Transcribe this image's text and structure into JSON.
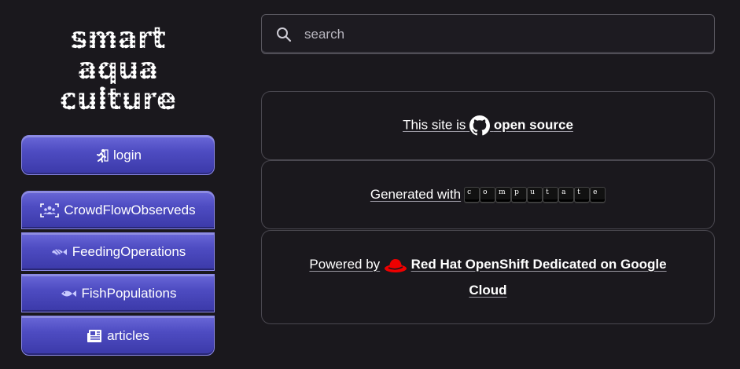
{
  "logo": {
    "lines": [
      "smart",
      "aqua",
      "culture"
    ]
  },
  "login": {
    "label": "login"
  },
  "menu": {
    "items": [
      {
        "label": "CrowdFlowObserveds",
        "icon": "people-scan-icon"
      },
      {
        "label": "FeedingOperations",
        "icon": "fish-food-icon"
      },
      {
        "label": "FishPopulations",
        "icon": "fish-icon"
      },
      {
        "label": "articles",
        "icon": "newspaper-icon"
      }
    ]
  },
  "search": {
    "placeholder": "search",
    "value": ""
  },
  "footer": {
    "open_source_prefix": "This site is",
    "open_source_link": "open source",
    "generated_prefix": "Generated with",
    "computate_letters": [
      "c",
      "o",
      "m",
      "p",
      "u",
      "t",
      "a",
      "t",
      "e"
    ],
    "powered_prefix": "Powered by",
    "powered_link_line1": "Red Hat OpenShift Dedicated on Google",
    "powered_link_line2": "Cloud"
  },
  "colors": {
    "background": "#1a181d",
    "button": "#4e4cc2",
    "redhat": "#ee0000"
  }
}
